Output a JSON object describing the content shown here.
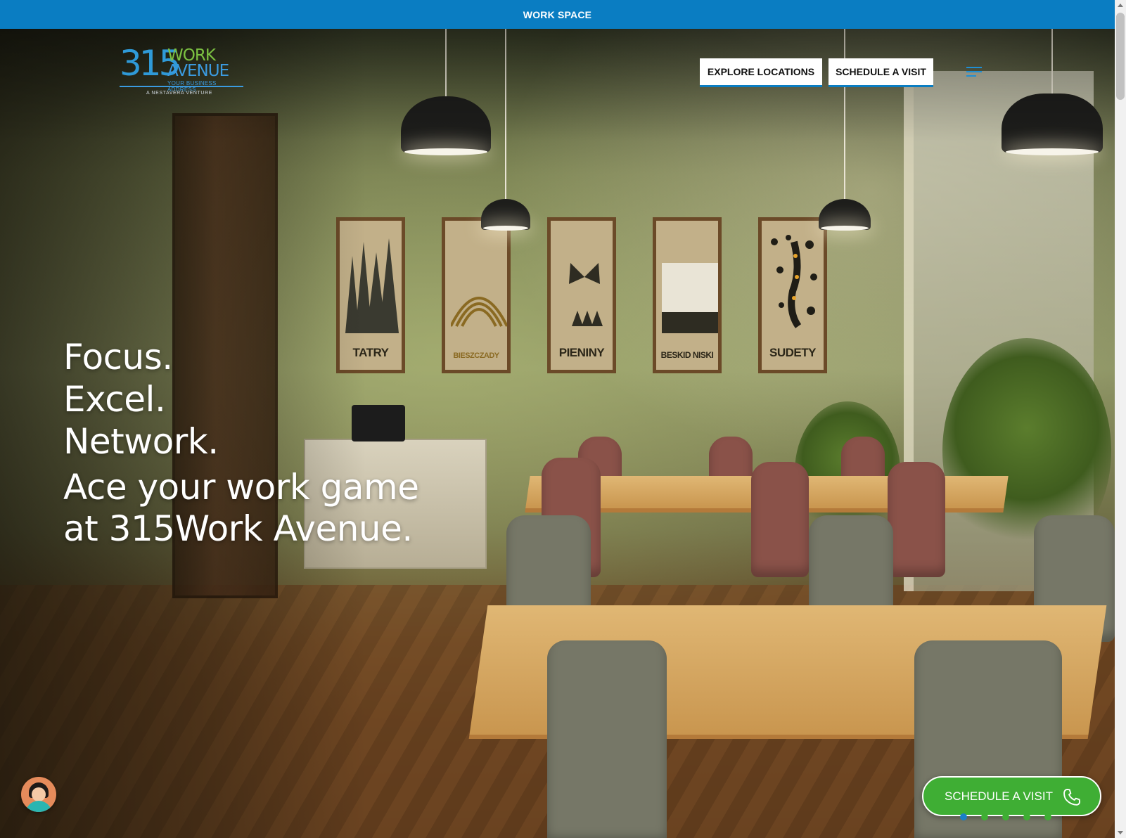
{
  "announcement": {
    "text": "WORK SPACE"
  },
  "logo": {
    "number": "315",
    "word_top": "WORK",
    "word_bottom": "AVENUE",
    "tagline": "YOUR BUSINESS ADDRESS",
    "subline": "A NESTAVERA VENTURE"
  },
  "nav": {
    "explore_label": "EXPLORE LOCATIONS",
    "schedule_label": "SCHEDULE A VISIT",
    "menu_icon": "hamburger-menu-icon"
  },
  "hero": {
    "lines": [
      "Focus.",
      "Excel.",
      "Network."
    ],
    "tagline_lines": [
      "Ace your work game",
      "at 315Work Avenue."
    ],
    "posters": [
      "TATRY",
      "BIESZCZADY",
      "PIENINY",
      "BESKID NISKI",
      "SUDETY"
    ]
  },
  "chat": {
    "icon": "chat-avatar-icon"
  },
  "cta": {
    "label": "SCHEDULE A VISIT",
    "icon": "phone-icon"
  },
  "slider": {
    "count": 5,
    "active_index": 0
  },
  "colors": {
    "accent_blue": "#0a7dc2",
    "cta_green": "#3fae34",
    "logo_green": "#7cc242"
  }
}
